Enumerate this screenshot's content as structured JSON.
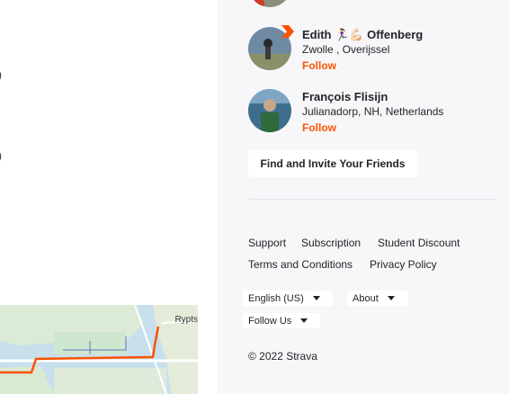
{
  "left_panel": {
    "fragments": [
      ")",
      ")"
    ],
    "map_label": "Rypts"
  },
  "athletes": [
    {
      "name": "Edith 🏃‍♀️💪🏻 Offenberg",
      "location": "Zwolle , Overijssel",
      "follow": "Follow",
      "subscriber_badge": true
    },
    {
      "name": "François Flisijn",
      "location": "Julianadorp, NH, Netherlands",
      "follow": "Follow",
      "subscriber_badge": false
    }
  ],
  "find_friends_label": "Find and Invite Your Friends",
  "footer": {
    "links": [
      "Support",
      "Subscription",
      "Student Discount",
      "Terms and Conditions",
      "Privacy Policy"
    ],
    "language": "English (US)",
    "about": "About",
    "follow_us": "Follow Us",
    "copyright": "© 2022 Strava"
  },
  "colors": {
    "accent": "#fc5200",
    "sidebar_bg": "#f7f7fa",
    "route": "#fc5200"
  }
}
